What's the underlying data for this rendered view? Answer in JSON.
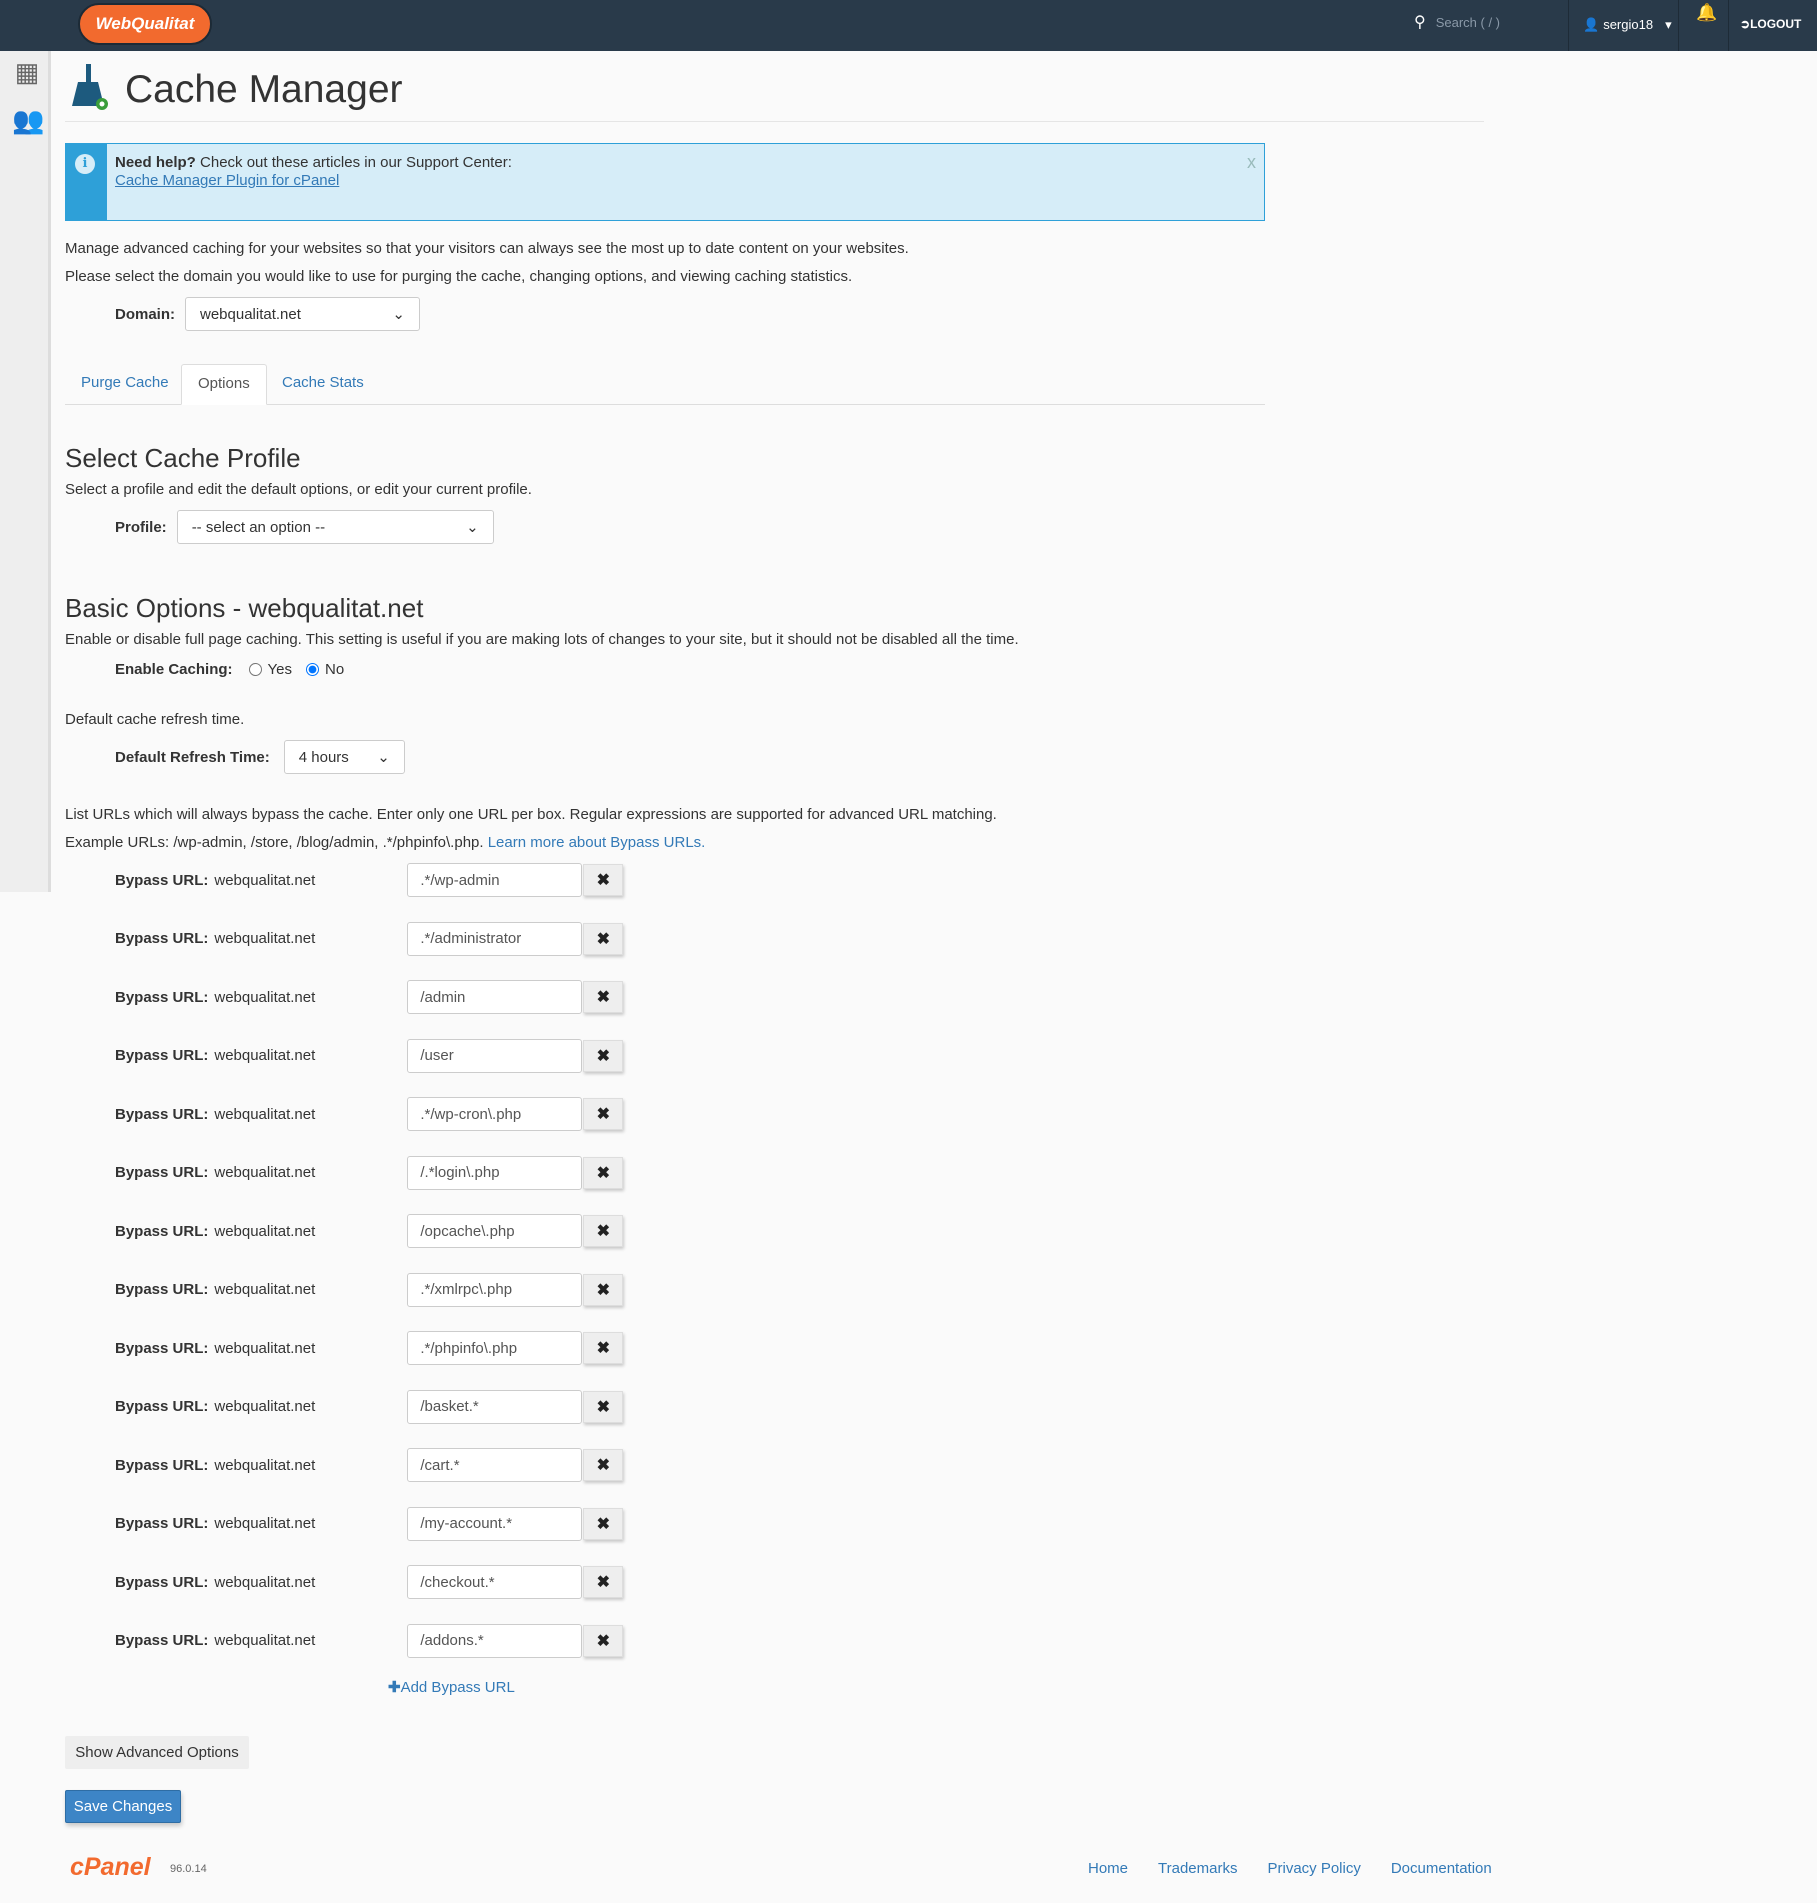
{
  "topbar": {
    "logo": "WebQualitat",
    "search_placeholder": "Search ( / )",
    "user": "sergio18",
    "logout": "LOGOUT"
  },
  "page": {
    "title": "Cache Manager"
  },
  "help": {
    "bold": "Need help?",
    "text": " Check out these articles in our Support Center:",
    "link": "Cache Manager Plugin for cPanel",
    "close": "x"
  },
  "intro": [
    "Manage advanced caching for your websites so that your visitors can always see the most up to date content on your websites.",
    "Please select the domain you would like to use for purging the cache, changing options, and viewing caching statistics."
  ],
  "domain": {
    "label": "Domain:",
    "value": "webqualitat.net"
  },
  "tabs": [
    "Purge Cache",
    "Options",
    "Cache Stats"
  ],
  "profile": {
    "heading": "Select Cache Profile",
    "desc": "Select a profile and edit the default options, or edit your current profile.",
    "label": "Profile:",
    "value": "-- select an option --"
  },
  "basic": {
    "heading": "Basic Options - webqualitat.net",
    "desc": "Enable or disable full page caching. This setting is useful if you are making lots of changes to your site, but it should not be disabled all the time.",
    "enable_label": "Enable Caching:",
    "yes": "Yes",
    "no": "No",
    "enable_value": "No",
    "refresh_desc": "Default cache refresh time.",
    "refresh_label": "Default Refresh Time:",
    "refresh_value": "4 hours",
    "bypass_desc": "List URLs which will always bypass the cache. Enter only one URL per box. Regular expressions are supported for advanced URL matching.",
    "example": "Example URLs: /wp-admin, /store, /blog/admin, .*/phpinfo\\.php. ",
    "example_link": "Learn more about Bypass URLs."
  },
  "bypass": {
    "label": "Bypass URL:",
    "domain": "webqualitat.net",
    "urls": [
      ".*/wp-admin",
      ".*/administrator",
      "/admin",
      "/user",
      ".*/wp-cron\\.php",
      "/.*login\\.php",
      "/opcache\\.php",
      ".*/xmlrpc\\.php",
      ".*/phpinfo\\.php",
      "/basket.*",
      "/cart.*",
      "/my-account.*",
      "/checkout.*",
      "/addons.*"
    ],
    "add": "Add Bypass URL"
  },
  "buttons": {
    "advanced": "Show Advanced Options",
    "save": "Save Changes"
  },
  "footer": {
    "brand": "cPanel",
    "version": "96.0.14",
    "links": [
      "Home",
      "Trademarks",
      "Privacy Policy",
      "Documentation"
    ]
  },
  "colors": {
    "topbar": "#293a4a",
    "accent": "#337ab7",
    "info": "#2ea0d8",
    "brand": "#f26a2e"
  }
}
